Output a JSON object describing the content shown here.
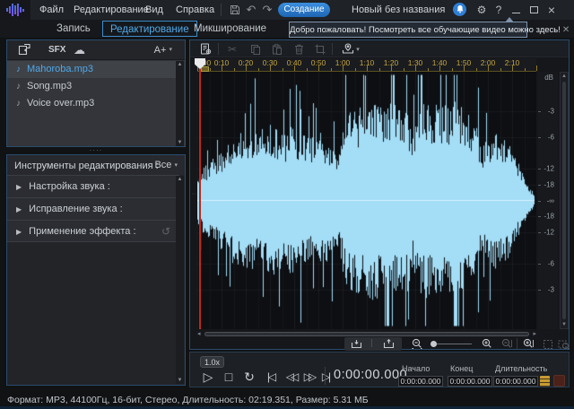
{
  "titlebar": {
    "menus": [
      "Файл",
      "Редактирование",
      "Вид",
      "Справка"
    ],
    "create_button": "Создание",
    "document_title": "Новый без названия"
  },
  "tabs": [
    {
      "label": "Запись",
      "active": false
    },
    {
      "label": "Редактирование",
      "active": true
    },
    {
      "label": "Микширование",
      "active": false
    }
  ],
  "tooltip": {
    "text": "Добро пожаловать! Посмотреть все обучающие видео можно здесь!",
    "close_glyph": "✕"
  },
  "library": {
    "sfx_label": "SFX",
    "font_button": "A+",
    "files": [
      {
        "name": "Mahoroba.mp3",
        "selected": true
      },
      {
        "name": "Song.mp3",
        "selected": false
      },
      {
        "name": "Voice over.mp3",
        "selected": false
      }
    ]
  },
  "tools": {
    "header": "Инструменты редактирования :",
    "filter": "Все",
    "sections": [
      "Настройка звука :",
      "Исправление звука :",
      "Применение эффекта :"
    ]
  },
  "timeline": {
    "labels": [
      "0:00",
      "0:10",
      "0:20",
      "0:30",
      "0:40",
      "0:50",
      "1:00",
      "1:10",
      "1:20",
      "1:30",
      "1:40",
      "1:50",
      "2:00",
      "2:10"
    ],
    "label_interval_seconds": 10,
    "minor_interval_seconds": 5,
    "total_seconds": 140
  },
  "waveform": {
    "color": "#a3ddf6",
    "center_line_color": "#e1f5ff",
    "playhead_color": "#c0281c",
    "duration_seconds": 139.351,
    "envelope": [
      0.22,
      0.3,
      0.36,
      0.42,
      0.46,
      0.55,
      0.62,
      0.58,
      0.63,
      0.6,
      0.66,
      0.69,
      0.63,
      0.6,
      0.66,
      0.61,
      0.58,
      0.56,
      0.61,
      0.56,
      0.5,
      0.47,
      0.78,
      0.86,
      0.82,
      0.86,
      0.9,
      0.86,
      0.89,
      0.86,
      0.82,
      0.86,
      0.6,
      0.84,
      0.88,
      0.86,
      0.9,
      0.86,
      0.88,
      0.85,
      0.8,
      0.74,
      0.5,
      0.56,
      0.62,
      0.56,
      0.52,
      0.4,
      0.28,
      0.14,
      0.05
    ]
  },
  "db_scale": {
    "unit": "dB",
    "center": "-∞",
    "marks": [
      {
        "label": "-3",
        "fraction": 0.708
      },
      {
        "label": "-6",
        "fraction": 0.501
      },
      {
        "label": "-12",
        "fraction": 0.251
      },
      {
        "label": "-18",
        "fraction": 0.126
      }
    ]
  },
  "transport": {
    "speed": "1.0x",
    "time": "0:00:00.000",
    "fields": [
      {
        "label": "Начало",
        "value": "0:00:00.000"
      },
      {
        "label": "Конец",
        "value": "0:00:00.000"
      },
      {
        "label": "Длительность",
        "value": "0:00:00.000"
      }
    ]
  },
  "statusbar": {
    "text": "Формат: MP3, 44100Гц, 16-бит, Стерео, Длительность: 02:19.351, Размер: 5.31 МБ"
  },
  "glyphs": {
    "dropdown": "▾",
    "note": "♪",
    "cloud": "☁",
    "scissors": "✂",
    "undo": "↶",
    "redo": "↷",
    "expand": "▶",
    "reset": "↺",
    "play": "▷",
    "stop": "□",
    "loop": "↻",
    "skip_start": "|◁",
    "rewind": "◁◁",
    "forward": "▷▷",
    "skip_end": "▷|",
    "gear": "⚙",
    "help": "?",
    "close": "×",
    "up": "▲",
    "down": "▼",
    "left": "◂",
    "right": "▸",
    "dots": "····",
    "vdots": "··"
  }
}
